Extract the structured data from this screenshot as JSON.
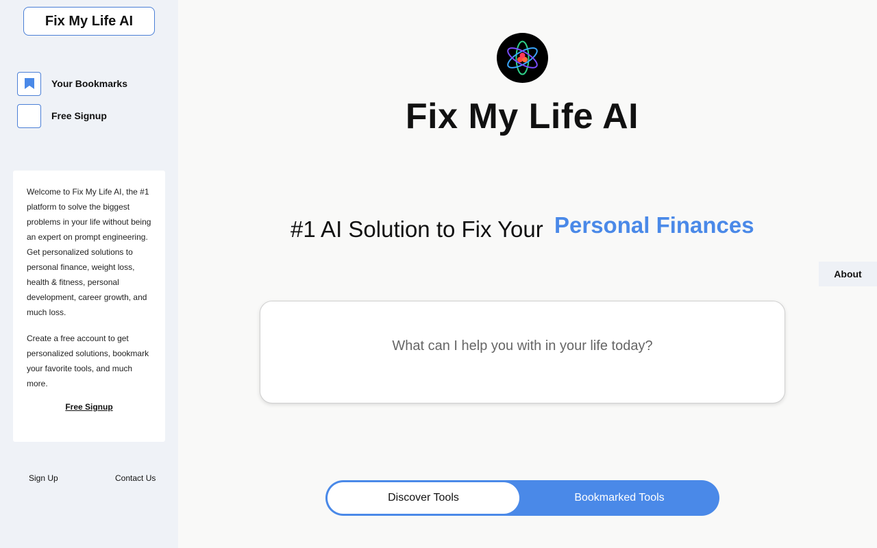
{
  "sidebar": {
    "brand": "Fix My Life AI",
    "nav": [
      {
        "label": "Your Bookmarks",
        "icon": "bookmark-icon"
      },
      {
        "label": "Free Signup",
        "icon": ""
      }
    ],
    "info": {
      "paragraph1": "Welcome to Fix My Life AI, the #1 platform to solve the biggest problems in your life without being an expert on prompt engineering. Get personalized solutions to personal finance, weight loss, health & fitness, personal development, career growth, and much loss.",
      "paragraph2": "Create a free account to get personalized solutions, bookmark your favorite tools, and much more.",
      "link": "Free Signup"
    },
    "footer": {
      "signup": "Sign Up",
      "contact": "Contact Us"
    }
  },
  "main": {
    "title": "Fix My Life AI",
    "headline": "#1 AI Solution to Fix Your",
    "headline_accent": "Personal Finances",
    "search_placeholder": "What can I help you with in your life today?",
    "toggle": {
      "active": "Discover Tools",
      "inactive": "Bookmarked Tools"
    },
    "about": "About"
  },
  "colors": {
    "accent": "#4a89e8",
    "sidebar_bg": "#eff2f7",
    "page_bg": "#f9f9f8"
  }
}
